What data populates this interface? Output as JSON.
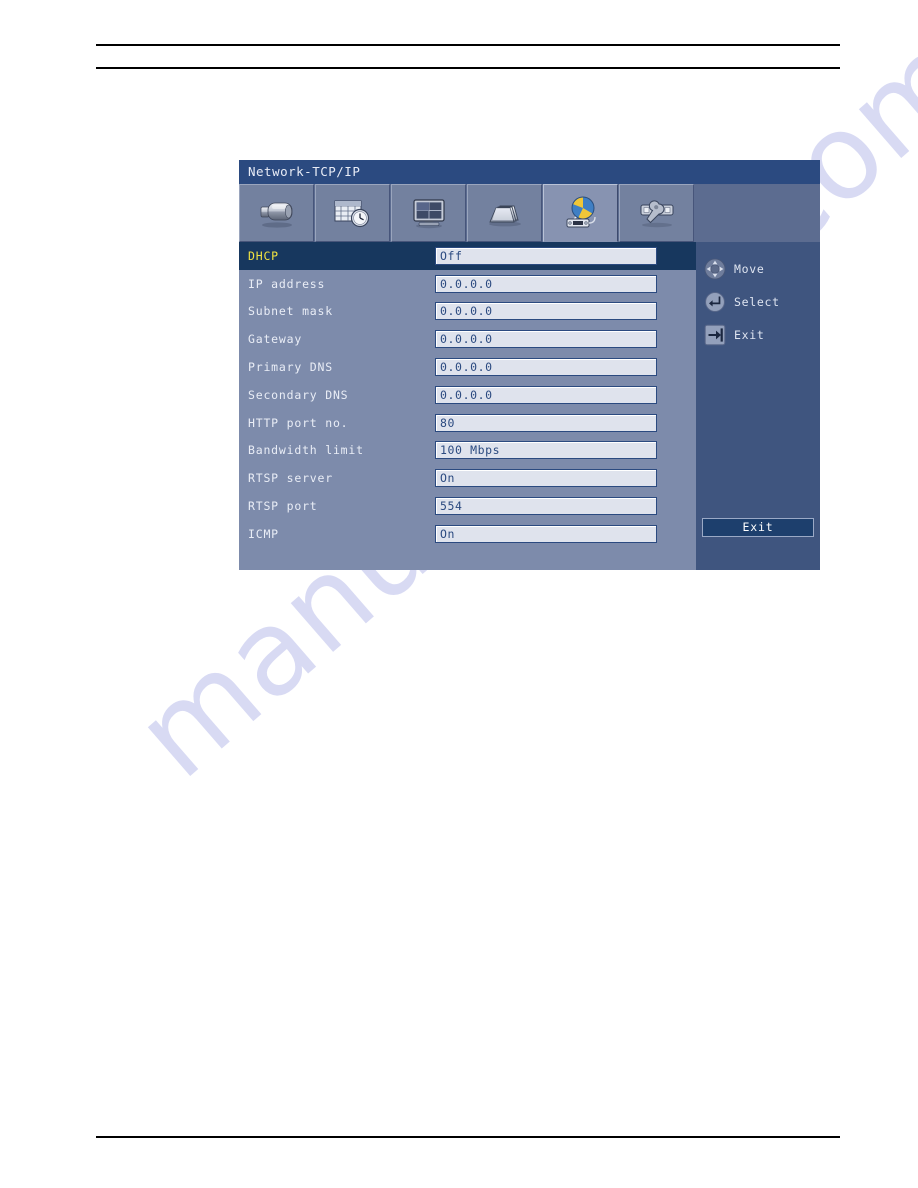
{
  "osd": {
    "title": "Network-TCP/IP",
    "tabs": [
      {
        "name": "camera",
        "icon": "camera-icon",
        "selected": false
      },
      {
        "name": "schedule",
        "icon": "schedule-icon",
        "selected": false
      },
      {
        "name": "display",
        "icon": "monitor-icon",
        "selected": false
      },
      {
        "name": "archive",
        "icon": "archive-icon",
        "selected": false
      },
      {
        "name": "network",
        "icon": "network-icon",
        "selected": true
      },
      {
        "name": "system",
        "icon": "wrench-icon",
        "selected": false
      }
    ],
    "menu_items": [
      {
        "label": "DHCP",
        "value": "Off",
        "selected": true
      },
      {
        "label": "IP address",
        "value": "0.0.0.0",
        "selected": false
      },
      {
        "label": "Subnet mask",
        "value": "0.0.0.0",
        "selected": false
      },
      {
        "label": "Gateway",
        "value": "0.0.0.0",
        "selected": false
      },
      {
        "label": "Primary DNS",
        "value": "0.0.0.0",
        "selected": false
      },
      {
        "label": "Secondary DNS",
        "value": "0.0.0.0",
        "selected": false
      },
      {
        "label": "HTTP port no.",
        "value": "80",
        "selected": false
      },
      {
        "label": "Bandwidth limit",
        "value": "100 Mbps",
        "selected": false
      },
      {
        "label": "RTSP server",
        "value": "On",
        "selected": false
      },
      {
        "label": "RTSP port",
        "value": "554",
        "selected": false
      },
      {
        "label": "ICMP",
        "value": "On",
        "selected": false
      }
    ],
    "help": {
      "move_label": "Move",
      "select_label": "Select",
      "exit_label": "Exit",
      "move_icon": "dpad-icon",
      "select_icon": "enter-key-icon",
      "exit_icon": "exit-arrow-icon"
    },
    "exit_button_label": "Exit"
  },
  "watermark": {
    "text": "manualshive.com"
  },
  "colors": {
    "title_bar": "#2b4a80",
    "panel_bg": "#7d8bab",
    "tabstrip_bg": "#5c6c90",
    "selected_row_bg": "#17375e",
    "selected_row_text": "#f2e441",
    "value_field_bg": "#dfe3ed",
    "value_field_text": "#2b4a80",
    "help_panel_bg": "#3f557f",
    "exit_button_bg": "#1d3f6d",
    "watermark": "#b9bdea"
  }
}
